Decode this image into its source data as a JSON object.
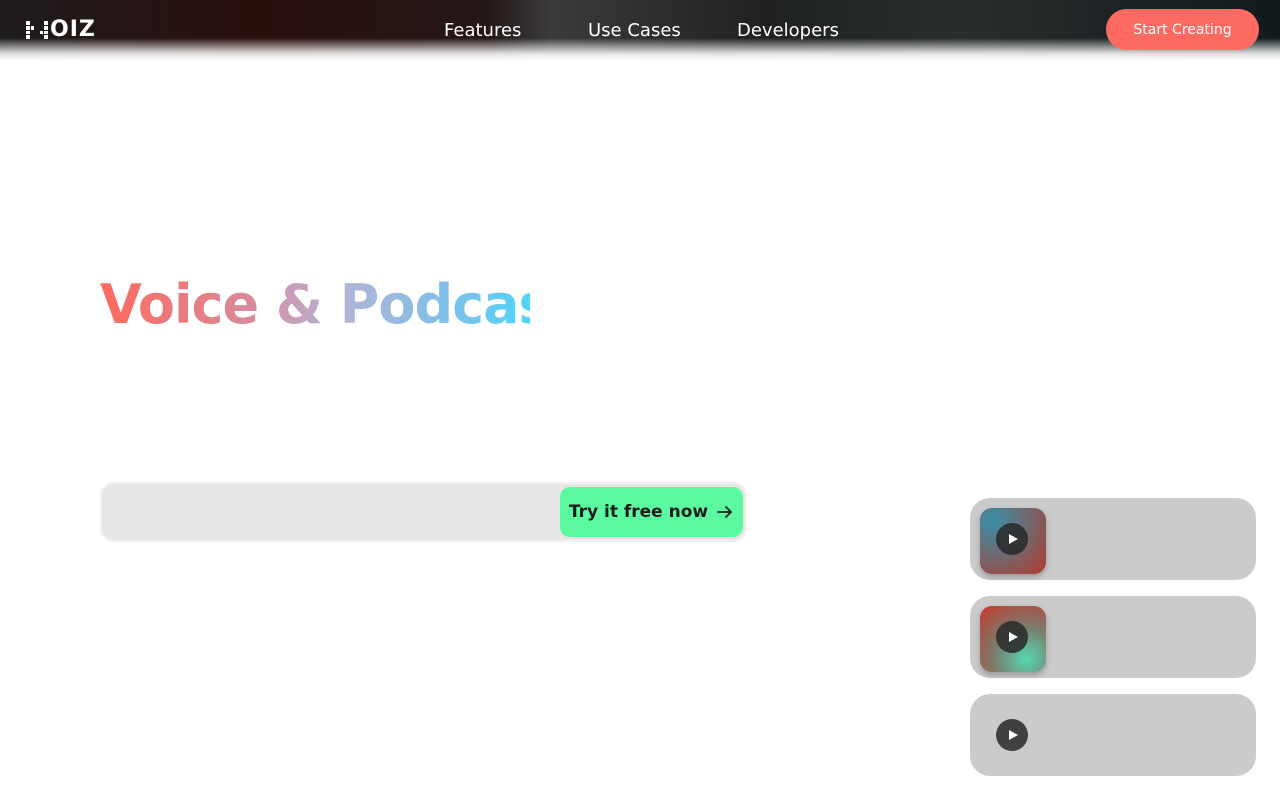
{
  "brand": {
    "logo_text": "OIZ",
    "logo_full": "NOIZ"
  },
  "nav": {
    "items": [
      {
        "label": "Features"
      },
      {
        "label": "Use Cases"
      },
      {
        "label": "Developers"
      }
    ],
    "cta_label": "Start Creating"
  },
  "hero": {
    "title": "Voice & Podcast",
    "prompt_placeholder": "",
    "try_button_label": "Try it free now",
    "try_button_icon": "arrow-right-icon"
  },
  "audio_cards": [
    {
      "thumbnail": "gradient-teal-red",
      "play_icon": "play-icon"
    },
    {
      "thumbnail": "gradient-red-mint",
      "play_icon": "play-icon"
    },
    {
      "thumbnail": "none",
      "play_icon": "play-icon"
    }
  ],
  "colors": {
    "accent_cta": "#ff6b63",
    "try_button": "#5cfaa0",
    "title_gradient_start": "#ff6a5e",
    "title_gradient_end": "#52d3fa",
    "card_background": "#cbcbcb"
  }
}
